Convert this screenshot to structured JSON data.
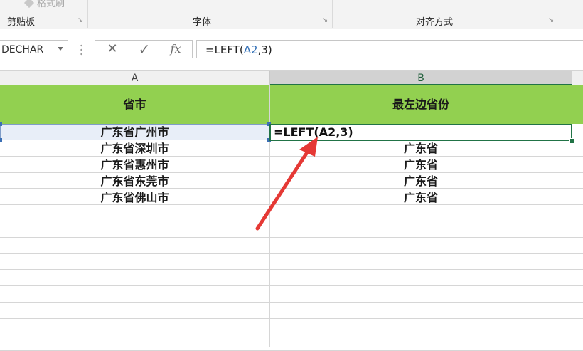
{
  "ribbon": {
    "format_painter": "格式刷",
    "groups": [
      "剪贴板",
      "字体",
      "对齐方式"
    ]
  },
  "formula_bar": {
    "name_box": "DECHAR",
    "cancel_icon": "✕",
    "enter_icon": "✓",
    "fx_label": "fx",
    "formula_prefix": "=LEFT(",
    "formula_ref": "A2",
    "formula_suffix": ",3)"
  },
  "columns": [
    "A",
    "B"
  ],
  "table": {
    "headers": [
      "省市",
      "最左边省份"
    ],
    "edit_text": "=LEFT(A2,3)",
    "rows": [
      {
        "a": "广东省广州市",
        "b": ""
      },
      {
        "a": "广东省深圳市",
        "b": "广东省"
      },
      {
        "a": "广东省惠州市",
        "b": "广东省"
      },
      {
        "a": "广东省东莞市",
        "b": "广东省"
      },
      {
        "a": "广东省佛山市",
        "b": "广东省"
      }
    ]
  },
  "colors": {
    "header_fill": "#92d050",
    "selection_green": "#217346",
    "arrow_red": "#e53935",
    "reference_blue": "#2f6db5"
  }
}
